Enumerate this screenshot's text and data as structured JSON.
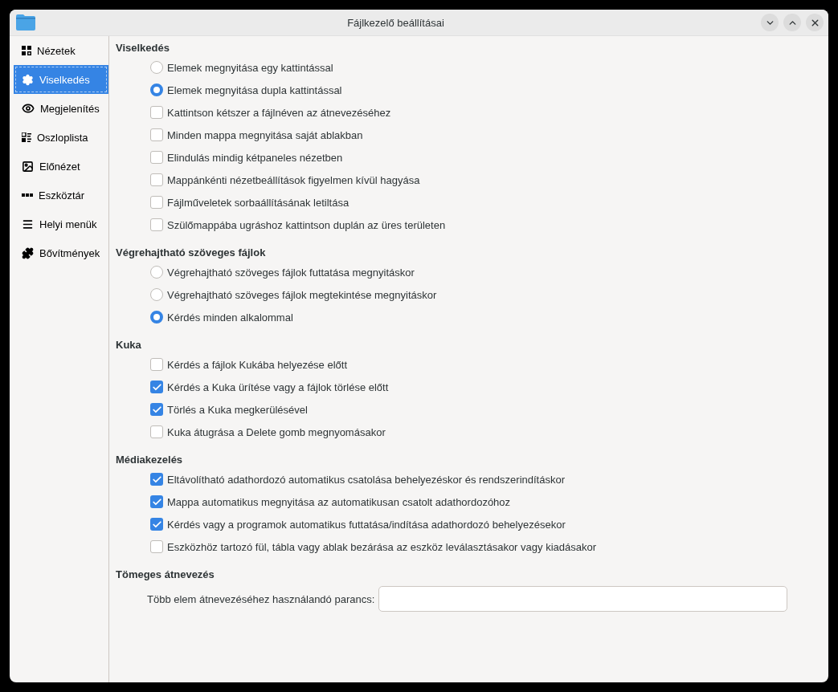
{
  "window": {
    "title": "Fájlkezelő beállításai"
  },
  "sidebar": {
    "items": [
      {
        "label": "Nézetek",
        "selected": false
      },
      {
        "label": "Viselkedés",
        "selected": true
      },
      {
        "label": "Megjelenítés",
        "selected": false
      },
      {
        "label": "Oszloplista",
        "selected": false
      },
      {
        "label": "Előnézet",
        "selected": false
      },
      {
        "label": "Eszköztár",
        "selected": false
      },
      {
        "label": "Helyi menük",
        "selected": false
      },
      {
        "label": "Bővítmények",
        "selected": false
      }
    ]
  },
  "sections": [
    {
      "title": "Viselkedés",
      "items": [
        {
          "kind": "radio",
          "label": "Elemek megnyitása egy kattintással",
          "selected": false
        },
        {
          "kind": "radio",
          "label": "Elemek megnyitása dupla kattintással",
          "selected": true
        },
        {
          "kind": "checkbox",
          "label": "Kattintson kétszer a fájlnéven az átnevezéséhez",
          "checked": false
        },
        {
          "kind": "checkbox",
          "label": "Minden mappa megnyitása saját ablakban",
          "checked": false
        },
        {
          "kind": "checkbox",
          "label": "Elindulás mindig kétpaneles nézetben",
          "checked": false
        },
        {
          "kind": "checkbox",
          "label": "Mappánkénti nézetbeállítások figyelmen kívül hagyása",
          "checked": false
        },
        {
          "kind": "checkbox",
          "label": "Fájlműveletek sorbaállításának letiltása",
          "checked": false
        },
        {
          "kind": "checkbox",
          "label": "Szülőmappába ugráshoz kattintson duplán az üres területen",
          "checked": false
        }
      ]
    },
    {
      "title": "Végrehajtható szöveges fájlok",
      "items": [
        {
          "kind": "radio",
          "label": "Végrehajtható szöveges fájlok futtatása megnyitáskor",
          "selected": false
        },
        {
          "kind": "radio",
          "label": "Végrehajtható szöveges fájlok megtekintése megnyitáskor",
          "selected": false
        },
        {
          "kind": "radio",
          "label": "Kérdés minden alkalommal",
          "selected": true
        }
      ]
    },
    {
      "title": "Kuka",
      "items": [
        {
          "kind": "checkbox",
          "label": "Kérdés a fájlok Kukába helyezése előtt",
          "checked": false
        },
        {
          "kind": "checkbox",
          "label": "Kérdés a Kuka ürítése vagy a fájlok törlése előtt",
          "checked": true
        },
        {
          "kind": "checkbox",
          "label": "Törlés a Kuka megkerülésével",
          "checked": true
        },
        {
          "kind": "checkbox",
          "label": "Kuka átugrása a Delete gomb megnyomásakor",
          "checked": false
        }
      ]
    },
    {
      "title": "Médiakezelés",
      "items": [
        {
          "kind": "checkbox",
          "label": "Eltávolítható adathordozó automatikus csatolása behelyezéskor és rendszerindításkor",
          "checked": true
        },
        {
          "kind": "checkbox",
          "label": "Mappa automatikus megnyitása az automatikusan csatolt adathordozóhoz",
          "checked": true
        },
        {
          "kind": "checkbox",
          "label": "Kérdés vagy a programok automatikus futtatása/indítása adathordozó behelyezésekor",
          "checked": true
        },
        {
          "kind": "checkbox",
          "label": "Eszközhöz tartozó fül, tábla vagy ablak bezárása az eszköz leválasztásakor vagy kiadásakor",
          "checked": false
        }
      ]
    },
    {
      "title": "Tömeges átnevezés",
      "items": [
        {
          "kind": "field",
          "label": "Több elem átnevezéséhez használandó parancs:"
        }
      ]
    }
  ]
}
